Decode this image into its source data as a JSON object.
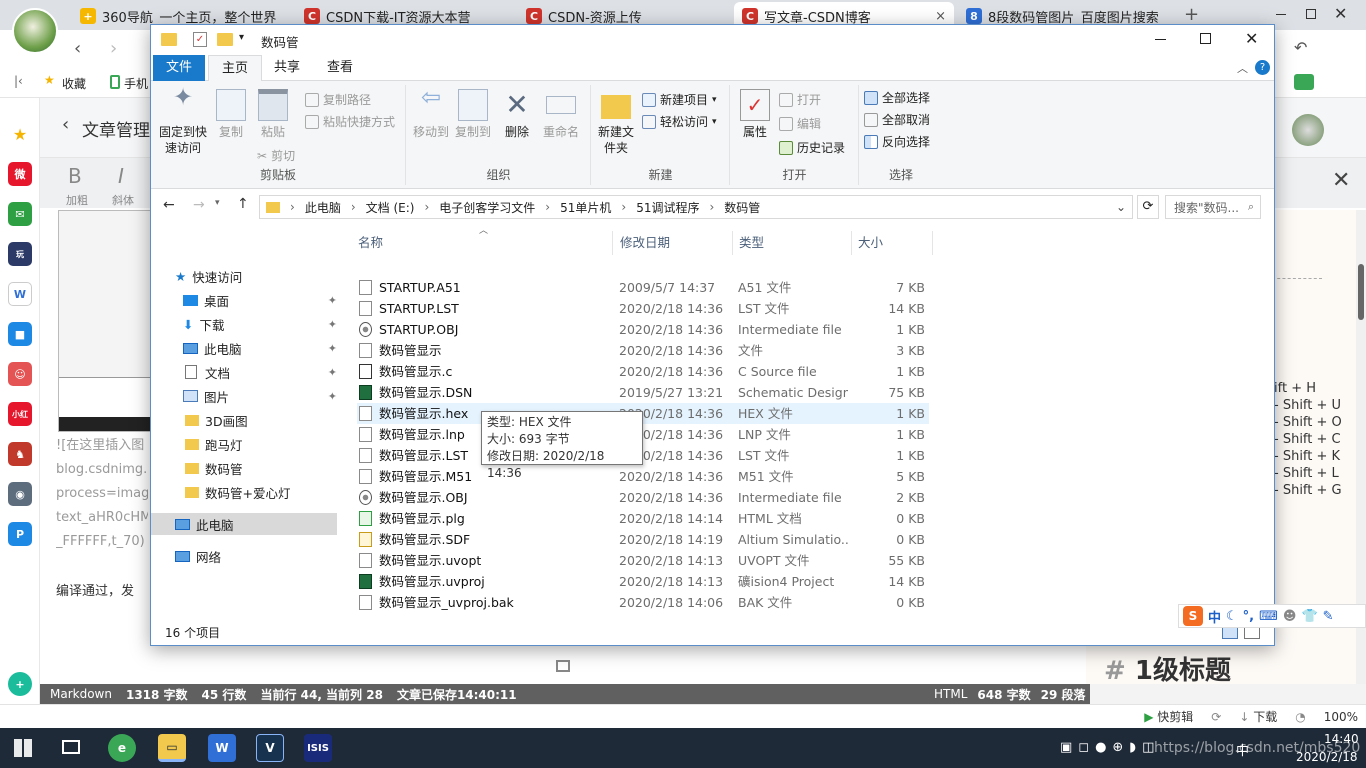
{
  "browser": {
    "tabs": [
      {
        "label": "360导航_一个主页，整个世界",
        "icon_color": "#f5b700"
      },
      {
        "label": "CSDN下载-IT资源大本营",
        "icon_color": "#d0342c"
      },
      {
        "label": "CSDN-资源上传",
        "icon_color": "#d0342c"
      },
      {
        "label": "写文章-CSDN博客",
        "icon_color": "#d0342c"
      },
      {
        "label": "8段数码管图片_百度图片搜索",
        "icon_color": "#2f6fd6"
      }
    ],
    "tab_close": "×",
    "new_tab": "+",
    "favorites_label": "收藏",
    "mobile_label": "手机"
  },
  "csdn": {
    "article_manage": "文章管理",
    "bold_label": "加粗",
    "italic_label": "斜体",
    "bold_glyph": "B",
    "italic_glyph": "I",
    "editor_lines": [
      "![在这里插入图",
      "blog.csdnimg.c",
      "process=imag",
      "text_aHR0cHM",
      "_FFFFFF,t_70)"
    ],
    "compiled_text": "编译通过，发",
    "shortcuts": [
      "ift + H",
      "- Shift + U",
      "- Shift + O",
      "- Shift + C",
      "- Shift + K",
      "- Shift + L",
      "- Shift + G"
    ],
    "heading_preview_hash": "#",
    "heading_preview": "1级标题",
    "status_left": [
      "Markdown",
      "1318 字数",
      "45 行数",
      "当前行 44, 当前列 28",
      "文章已保存14:40:11"
    ],
    "status_right": [
      "HTML",
      "648 字数",
      "29 段落"
    ]
  },
  "bottom_bar": [
    "快剪辑",
    "下载",
    "100%"
  ],
  "taskbar": {
    "time": "14:40",
    "date": "2020/2/18",
    "input_lang": "中",
    "watermark": "https://blog.csdn.net/mbs520"
  },
  "explorer": {
    "title": "数码管",
    "ribbon_tabs": [
      "文件",
      "主页",
      "共享",
      "查看"
    ],
    "groups": {
      "clipboard": {
        "label": "剪贴板",
        "pin": "固定到快速访问",
        "copy": "复制",
        "paste": "粘贴",
        "copy_path": "复制路径",
        "paste_shortcut": "粘贴快捷方式",
        "cut": "剪切"
      },
      "organize": {
        "label": "组织",
        "move_to": "移动到",
        "copy_to": "复制到",
        "delete": "删除",
        "rename": "重命名"
      },
      "new": {
        "label": "新建",
        "new_folder": "新建文件夹",
        "new_item": "新建项目",
        "easy_access": "轻松访问"
      },
      "open": {
        "label": "打开",
        "properties": "属性",
        "open": "打开",
        "edit": "编辑",
        "history": "历史记录"
      },
      "select": {
        "label": "选择",
        "select_all": "全部选择",
        "select_none": "全部取消",
        "invert": "反向选择"
      }
    },
    "breadcrumb": [
      "此电脑",
      "文档 (E:)",
      "电子创客学习文件",
      "51单片机",
      "51调试程序",
      "数码管"
    ],
    "search_placeholder": "搜索\"数码...",
    "nav": [
      {
        "label": "快速访问",
        "pinned": false
      },
      {
        "label": "桌面",
        "pinned": true
      },
      {
        "label": "下载",
        "pinned": true
      },
      {
        "label": "此电脑",
        "pinned": true
      },
      {
        "label": "文档",
        "pinned": true
      },
      {
        "label": "图片",
        "pinned": true
      },
      {
        "label": "3D画图",
        "pinned": false
      },
      {
        "label": "跑马灯",
        "pinned": false
      },
      {
        "label": "数码管",
        "pinned": false
      },
      {
        "label": "数码管+爱心灯",
        "pinned": false
      },
      {
        "label": "此电脑",
        "pinned": false
      },
      {
        "label": "网络",
        "pinned": false
      }
    ],
    "columns": [
      "名称",
      "修改日期",
      "类型",
      "大小"
    ],
    "files": [
      {
        "name": "STARTUP.A51",
        "date": "2009/5/7 14:37",
        "type": "A51 文件",
        "size": "7 KB",
        "icon": "file"
      },
      {
        "name": "STARTUP.LST",
        "date": "2020/2/18 14:36",
        "type": "LST 文件",
        "size": "14 KB",
        "icon": "file"
      },
      {
        "name": "STARTUP.OBJ",
        "date": "2020/2/18 14:36",
        "type": "Intermediate file",
        "size": "1 KB",
        "icon": "obj"
      },
      {
        "name": "数码管显示",
        "date": "2020/2/18 14:36",
        "type": "文件",
        "size": "3 KB",
        "icon": "file"
      },
      {
        "name": "数码管显示.c",
        "date": "2020/2/18 14:36",
        "type": "C Source file",
        "size": "1 KB",
        "icon": "c"
      },
      {
        "name": "数码管显示.DSN",
        "date": "2019/5/27 13:21",
        "type": "Schematic Design",
        "size": "75 KB",
        "icon": "dsn"
      },
      {
        "name": "数码管显示.hex",
        "date": "2020/2/18 14:36",
        "type": "HEX 文件",
        "size": "1 KB",
        "icon": "file"
      },
      {
        "name": "数码管显示.lnp",
        "date": "2020/2/18 14:36",
        "type": "LNP 文件",
        "size": "1 KB",
        "icon": "file"
      },
      {
        "name": "数码管显示.LST",
        "date": "2020/2/18 14:36",
        "type": "LST 文件",
        "size": "1 KB",
        "icon": "file"
      },
      {
        "name": "数码管显示.M51",
        "date": "2020/2/18 14:36",
        "type": "M51 文件",
        "size": "5 KB",
        "icon": "file"
      },
      {
        "name": "数码管显示.OBJ",
        "date": "2020/2/18 14:36",
        "type": "Intermediate file",
        "size": "2 KB",
        "icon": "obj"
      },
      {
        "name": "数码管显示.plg",
        "date": "2020/2/18 14:14",
        "type": "HTML 文档",
        "size": "0 KB",
        "icon": "plg"
      },
      {
        "name": "数码管显示.SDF",
        "date": "2020/2/18 14:19",
        "type": "Altium Simulatio...",
        "size": "0 KB",
        "icon": "sdf"
      },
      {
        "name": "数码管显示.uvopt",
        "date": "2020/2/18 14:13",
        "type": "UVOPT 文件",
        "size": "55 KB",
        "icon": "file"
      },
      {
        "name": "数码管显示.uvproj",
        "date": "2020/2/18 14:13",
        "type": "礦ision4 Project",
        "size": "14 KB",
        "icon": "uv"
      },
      {
        "name": "数码管显示_uvproj.bak",
        "date": "2020/2/18 14:06",
        "type": "BAK 文件",
        "size": "0 KB",
        "icon": "file"
      }
    ],
    "hovered_row": "数码管显示.hex",
    "tooltip": [
      "类型: HEX 文件",
      "大小: 693 字节",
      "修改日期: 2020/2/18 14:36"
    ],
    "item_count": "16 个项目"
  },
  "colors": {
    "accent": "#1979ca",
    "hover_row": "#e5f3ff",
    "taskbar": "#1f2a38",
    "csdn_red": "#d0342c"
  }
}
